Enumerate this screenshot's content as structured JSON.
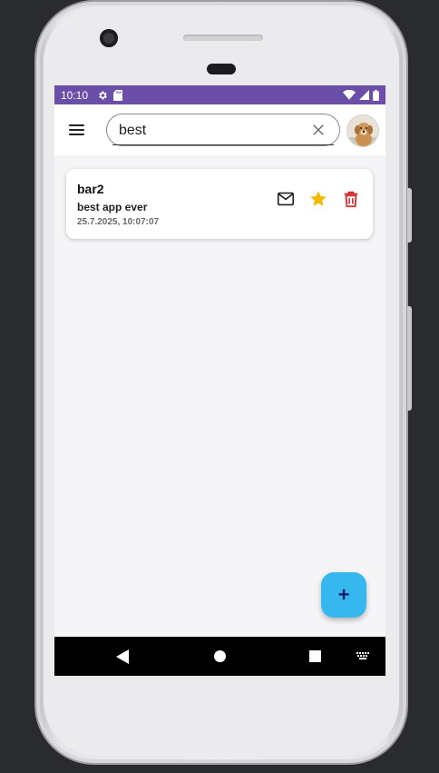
{
  "status_bar": {
    "time": "10:10",
    "color": "#6a4ea8",
    "left_icons": [
      "settings-icon",
      "sd-card-icon"
    ],
    "right_icons": [
      "wifi-icon",
      "signal-icon",
      "battery-icon"
    ]
  },
  "app_bar": {
    "menu_icon": "menu-icon",
    "search": {
      "value": "best",
      "clear_icon": "close-icon"
    },
    "avatar_icon": "dog-avatar"
  },
  "notes": [
    {
      "title": "bar2",
      "body": "best app ever",
      "date": "25.7.2025, 10:07:07",
      "actions": {
        "mail_icon": "mail-icon",
        "star_icon": "star-icon",
        "star_color": "#f5b800",
        "delete_icon": "trash-icon",
        "delete_color": "#d32f2f"
      }
    }
  ],
  "fab": {
    "label": "+",
    "color": "#36b8ee"
  },
  "navigation_bar": {
    "buttons": [
      "back-icon",
      "home-icon",
      "recents-icon",
      "keyboard-icon"
    ]
  }
}
